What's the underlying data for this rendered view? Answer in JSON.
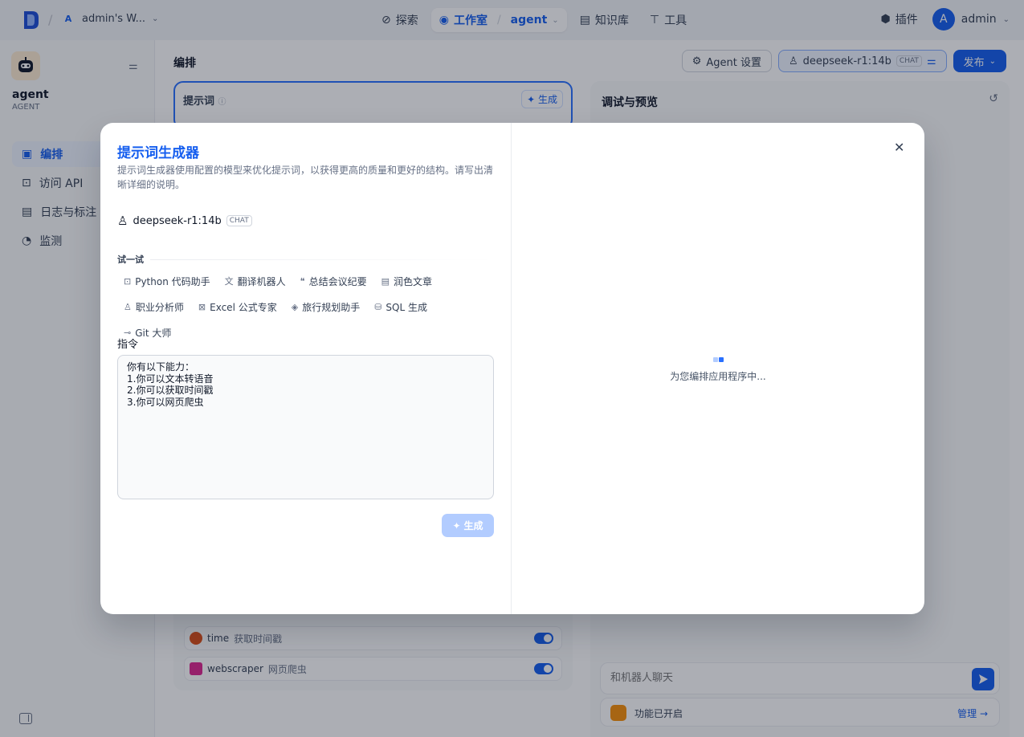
{
  "workspace": {
    "initial": "A",
    "name": "admin's W..."
  },
  "nav": {
    "explore": "探索",
    "studio": "工作室",
    "current_app": "agent",
    "knowledge": "知识库",
    "tools": "工具",
    "plugins": "插件",
    "user_initial": "A",
    "user_name": "admin"
  },
  "sidebar": {
    "app_name": "agent",
    "app_type": "AGENT",
    "items": [
      {
        "label": "编排",
        "icon": "layout-icon",
        "active": true
      },
      {
        "label": "访问 API",
        "icon": "terminal-icon",
        "active": false
      },
      {
        "label": "日志与标注",
        "icon": "file-list-icon",
        "active": false
      },
      {
        "label": "监测",
        "icon": "gauge-icon",
        "active": false
      }
    ]
  },
  "main": {
    "title": "编排",
    "agent_settings": "Agent 设置",
    "model_name": "deepseek-r1:14b",
    "model_badge": "CHAT",
    "publish": "发布",
    "prompt_label": "提示词",
    "prompt_generate": "生成",
    "tools": [
      {
        "name": "time",
        "desc": "获取时间戳",
        "color": "#e04f16"
      },
      {
        "name": "webscraper",
        "desc": "网页爬虫",
        "color": "#dd2590"
      }
    ]
  },
  "preview": {
    "title": "调试与预览",
    "chat_placeholder": "和机器人聊天",
    "feature_text": "功能已开启",
    "manage": "管理"
  },
  "modal": {
    "title": "提示词生成器",
    "description": "提示词生成器使用配置的模型来优化提示词，以获得更高的质量和更好的结构。请写出清晰详细的说明。",
    "model_name": "deepseek-r1:14b",
    "model_badge": "CHAT",
    "try_label": "试一试",
    "templates": [
      {
        "label": "Python 代码助手",
        "icon": "terminal-icon"
      },
      {
        "label": "翻译机器人",
        "icon": "translate-icon"
      },
      {
        "label": "总结会议纪要",
        "icon": "quote-icon"
      },
      {
        "label": "润色文章",
        "icon": "article-icon"
      },
      {
        "label": "职业分析师",
        "icon": "user-icon"
      },
      {
        "label": "Excel 公式专家",
        "icon": "excel-icon"
      },
      {
        "label": "旅行规划助手",
        "icon": "map-pin-icon"
      },
      {
        "label": "SQL 生成",
        "icon": "database-icon"
      },
      {
        "label": "Git 大师",
        "icon": "git-commit-icon"
      }
    ],
    "instruction_label": "指令",
    "instruction_text": "你有以下能力：\n1.你可以文本转语音\n2.你可以获取时间戳\n3.你可以网页爬虫",
    "generate": "生成",
    "loading_text": "为您编排应用程序中..."
  },
  "colors": {
    "accent": "#155eef",
    "accent_light": "#b2ccff"
  }
}
